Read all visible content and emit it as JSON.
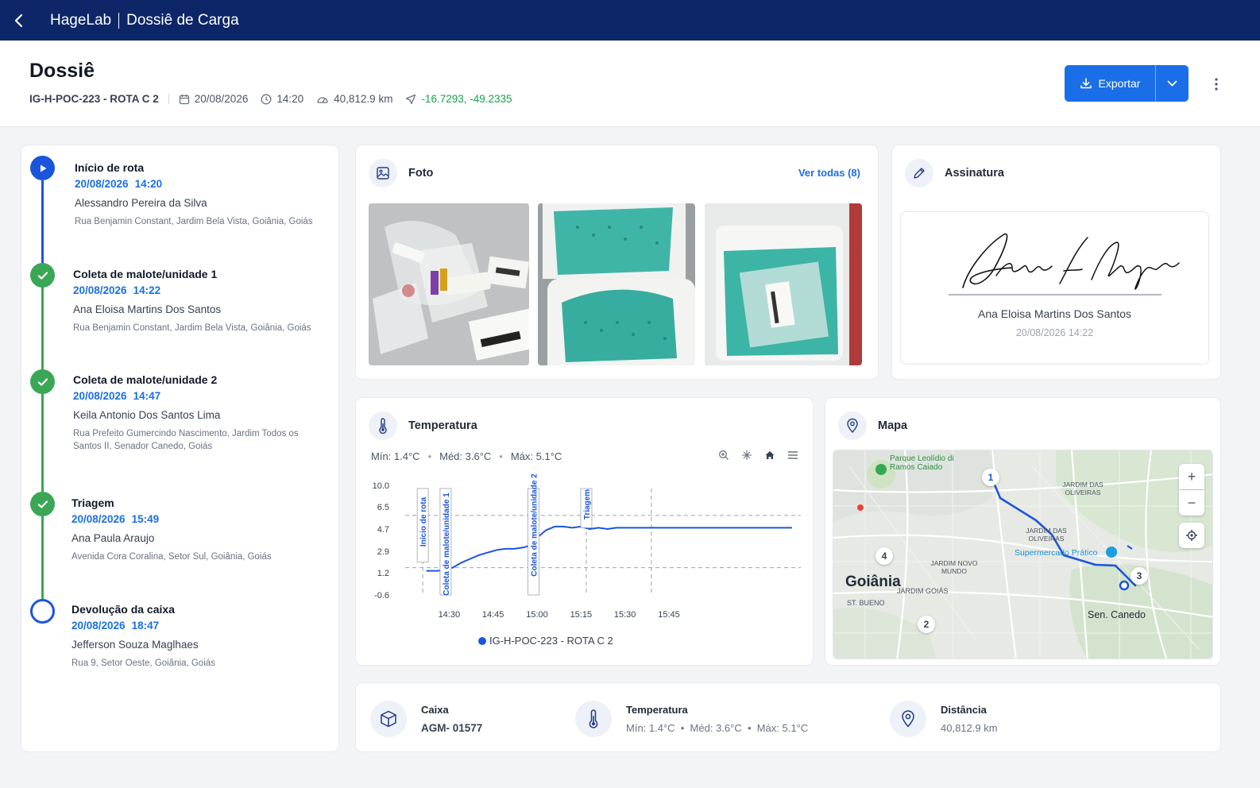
{
  "topbar": {
    "app": "HageLab",
    "page": "Dossiê de Carga"
  },
  "header": {
    "title": "Dossiê",
    "code": "IG-H-POC-223 - ROTA C 2",
    "date": "20/08/2026",
    "time": "14:20",
    "distance": "40,812.9 km",
    "coords": "-16.7293, -49.2335",
    "export_label": "Exportar"
  },
  "timeline": [
    {
      "title": "Início de rota",
      "date": "20/08/2026",
      "time": "14:20",
      "person": "Alessandro Pereira da Silva",
      "address": "Rua Benjamin Constant, Jardim Bela Vista, Goiânia, Goiás",
      "status": "current"
    },
    {
      "title": "Coleta de malote/unidade 1",
      "date": "20/08/2026",
      "time": "14:22",
      "person": "Ana Eloisa Martins Dos Santos",
      "address": "Rua Benjamin Constant, Jardim Bela Vista, Goiânia, Goiás",
      "status": "done"
    },
    {
      "title": "Coleta de malote/unidade 2",
      "date": "20/08/2026",
      "time": "14:47",
      "person": "Keila Antonio Dos Santos Lima",
      "address": "Rua Prefeito Gumercindo Nascimento, Jardim Todos os Santos II, Senador Canedo, Goiás",
      "status": "done"
    },
    {
      "title": "Triagem",
      "date": "20/08/2026",
      "time": "15:49",
      "person": "Ana Paula Araujo",
      "address": "Avenida Cora Coralina, Setor Sul, Goiânia, Goiás",
      "status": "done"
    },
    {
      "title": "Devolução da caixa",
      "date": "20/08/2026",
      "time": "18:47",
      "person": "Jefferson Souza Maglhaes",
      "address": "Rua 9, Setor Oeste, Goiânia, Goiás",
      "status": "pending"
    }
  ],
  "foto": {
    "title": "Foto",
    "see_all": "Ver todas (8)"
  },
  "assinatura": {
    "title": "Assinatura",
    "signer": "Ana Eloisa Martins Dos Santos",
    "datetime": "20/08/2026 14:22"
  },
  "temperatura": {
    "title": "Temperatura",
    "min": "Mín: 1.4°C",
    "avg": "Méd: 3.6°C",
    "max": "Máx: 5.1°C",
    "sep": "•"
  },
  "chart_data": {
    "type": "line",
    "y_ticks": [
      "10.0",
      "6.5",
      "4.7",
      "2.9",
      "1.2",
      "-0.6"
    ],
    "x_ticks": [
      "14:30",
      "14:45",
      "15:00",
      "15:15",
      "15:30",
      "15:45"
    ],
    "series": [
      {
        "name": "IG-H-POC-223 - ROTA C 2",
        "points": [
          [
            14.37,
            1.35
          ],
          [
            14.43,
            1.35
          ],
          [
            14.47,
            1.4
          ],
          [
            14.52,
            1.6
          ],
          [
            14.57,
            2.0
          ],
          [
            14.62,
            2.3
          ],
          [
            14.67,
            2.6
          ],
          [
            14.72,
            2.8
          ],
          [
            14.77,
            3.0
          ],
          [
            14.82,
            3.1
          ],
          [
            14.87,
            3.1
          ],
          [
            14.92,
            3.2
          ],
          [
            14.97,
            3.4
          ],
          [
            15.0,
            4.0
          ],
          [
            15.05,
            4.6
          ],
          [
            15.1,
            4.9
          ],
          [
            15.15,
            4.9
          ],
          [
            15.2,
            4.8
          ],
          [
            15.25,
            4.9
          ],
          [
            15.3,
            4.7
          ],
          [
            15.35,
            4.8
          ],
          [
            15.4,
            4.7
          ],
          [
            15.45,
            4.8
          ],
          [
            15.5,
            4.8
          ],
          [
            15.6,
            4.8
          ],
          [
            15.75,
            4.8
          ],
          [
            15.9,
            4.8
          ],
          [
            16.1,
            4.8
          ],
          [
            16.3,
            4.8
          ],
          [
            16.45,
            4.8
          ]
        ]
      }
    ],
    "event_markers": [
      {
        "label": "Início de rota"
      },
      {
        "label": "Coleta de malote/unidade 1"
      },
      {
        "label": "Coleta de malote/unidade 2"
      },
      {
        "label": "Triagem"
      }
    ],
    "grid": true,
    "legend": "bottom"
  },
  "mapa": {
    "title": "Mapa",
    "labels": [
      "Goiânia",
      "Sen. Canedo",
      "JARDIM DAS OLIVEIRAS",
      "JARDIM NOVO MUNDO",
      "JARDIM GOIÁS",
      "ST. BUENO",
      "Supermercado Prático",
      "Parque Leolídio di Ramos Caiado",
      "JARDIM DAS OLIVEIRAS"
    ],
    "markers": [
      "1",
      "2",
      "3",
      "4"
    ],
    "zoom_in": "+",
    "zoom_out": "−"
  },
  "bottom": {
    "caixa_label": "Caixa",
    "caixa_value": "AGM- 01577",
    "temp_label": "Temperatura",
    "temp_value": "Mín: 1.4°C  •  Méd: 3.6°C  •  Máx: 5.1°C",
    "dist_label": "Distância",
    "dist_value": "40,812.9 km"
  },
  "colors": {
    "navy": "#0c2668",
    "primary": "#1a6fe8",
    "success": "#3aa757",
    "line": "#1a56db"
  }
}
